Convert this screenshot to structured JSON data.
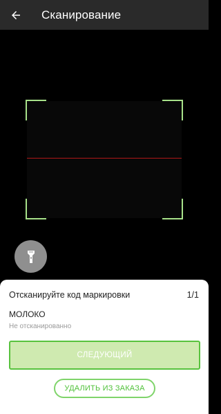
{
  "header": {
    "title": "Сканирование",
    "back_icon": "arrow-left-icon"
  },
  "camera": {
    "flash_icon": "flashlight-icon"
  },
  "sheet": {
    "instruction": "Отсканируйте код маркировки",
    "counter": "1/1",
    "product_name": "МОЛОКО",
    "status": "Не отсканированно",
    "next_label": "СЛЕДУЮЩИЙ",
    "remove_label": "УДАЛИТЬ ИЗ ЗАКАЗА"
  },
  "colors": {
    "accent": "#58c23e",
    "frame": "#a8e28a",
    "scan_line": "#b01818",
    "appbar": "#2a2a2a"
  }
}
